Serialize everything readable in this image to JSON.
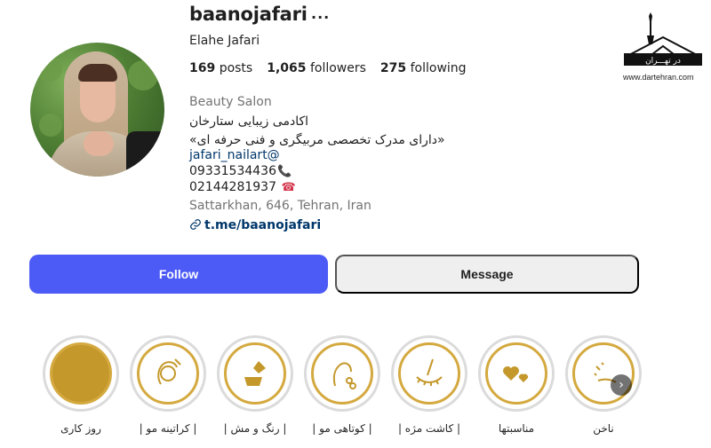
{
  "profile": {
    "username": "baanojafari",
    "full_name": "Elahe Jafari",
    "more_icon": "more-icon",
    "stats": {
      "posts_count": "169",
      "posts_label": "posts",
      "followers_count": "1,065",
      "followers_label": "followers",
      "following_count": "275",
      "following_label": "following"
    },
    "category": "Beauty Salon",
    "bio_line1": "اکادمی زیبایی ستارخان",
    "bio_line2": "«دارای مدرک تخصصی مربیگری و فنی حرفه ای»",
    "mention": "jafari_nailart@",
    "phone1": "09331534436",
    "phone1_emoji": "📞",
    "phone2": "02144281937",
    "phone2_emoji": "☎",
    "address": "Sattarkhan, 646, Tehran, Iran",
    "link": "t.me/baanojafari",
    "link_icon": "link-icon"
  },
  "actions": {
    "follow_label": "Follow",
    "message_label": "Message"
  },
  "highlights": [
    {
      "label": "روز کاری",
      "icon": "gold-circle-icon"
    },
    {
      "label": "| کراتینه مو |",
      "icon": "hair-face-icon"
    },
    {
      "label": "| رنگ و مش |",
      "icon": "hair-dye-brush-icon"
    },
    {
      "label": "| کوتاهی مو |",
      "icon": "haircut-scissors-icon"
    },
    {
      "label": "| کاشت مژه |",
      "icon": "eyelash-icon"
    },
    {
      "label": "مناسبتها",
      "icon": "hearts-icon"
    },
    {
      "label": "ناخن",
      "icon": "nail-polish-icon"
    }
  ],
  "watermark": {
    "text": "در تهـــران",
    "url": "www.dartehran.com"
  },
  "colors": {
    "follow_bg": "#4c5bf6",
    "message_bg": "#efefef",
    "gold": "#c4982b",
    "link": "#00376b"
  }
}
